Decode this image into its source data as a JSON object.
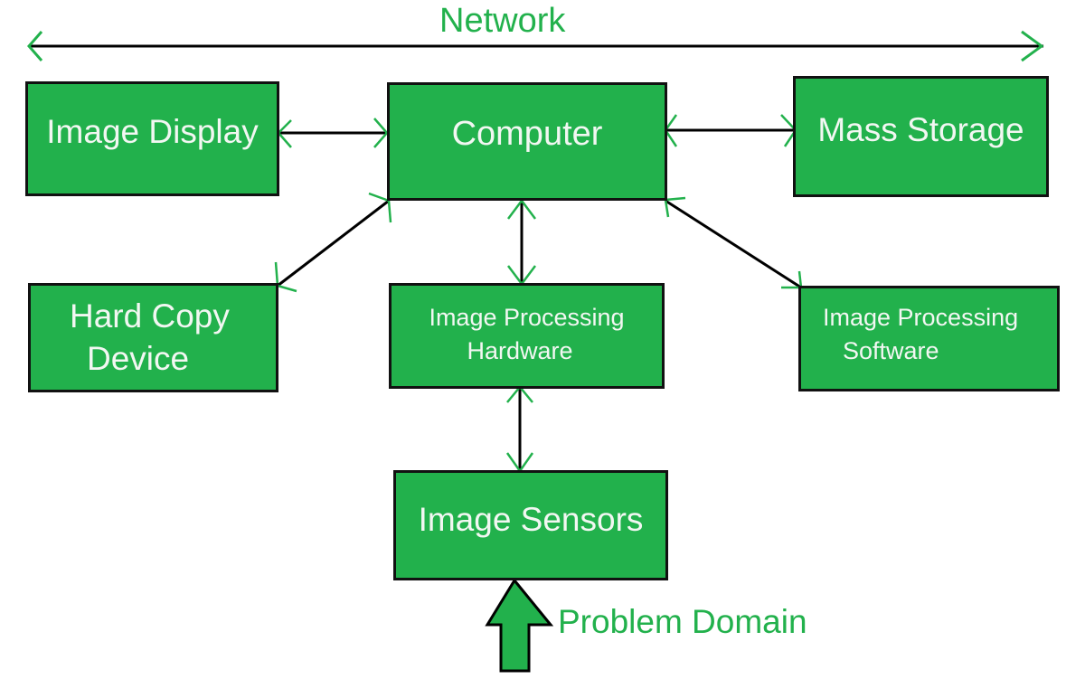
{
  "title": "Network",
  "colors": {
    "box_fill": "#22b14c",
    "box_border": "#111111",
    "box_text": "#f2f7f2",
    "accent": "#22b14c",
    "connector": "#000000"
  },
  "nodes": {
    "image_display": {
      "label": "Image Display"
    },
    "computer": {
      "label": "Computer"
    },
    "mass_storage": {
      "label": "Mass Storage"
    },
    "hard_copy_device": {
      "label_lines": [
        "Hard Copy",
        "Device"
      ]
    },
    "image_processing_hardware": {
      "label_lines": [
        "Image Processing",
        "Hardware"
      ]
    },
    "image_processing_software": {
      "label_lines": [
        "Image Processing",
        "Software"
      ]
    },
    "image_sensors": {
      "label": "Image Sensors"
    }
  },
  "input_label": "Problem Domain",
  "connections": [
    {
      "from": "image_display",
      "to": "computer",
      "type": "bidirectional"
    },
    {
      "from": "computer",
      "to": "mass_storage",
      "type": "bidirectional"
    },
    {
      "from": "computer",
      "to": "hard_copy_device",
      "type": "bidirectional"
    },
    {
      "from": "computer",
      "to": "image_processing_hardware",
      "type": "bidirectional"
    },
    {
      "from": "computer",
      "to": "image_processing_software",
      "type": "bidirectional"
    },
    {
      "from": "image_processing_hardware",
      "to": "image_sensors",
      "type": "bidirectional"
    },
    {
      "from": "problem_domain",
      "to": "image_sensors",
      "type": "input"
    }
  ]
}
